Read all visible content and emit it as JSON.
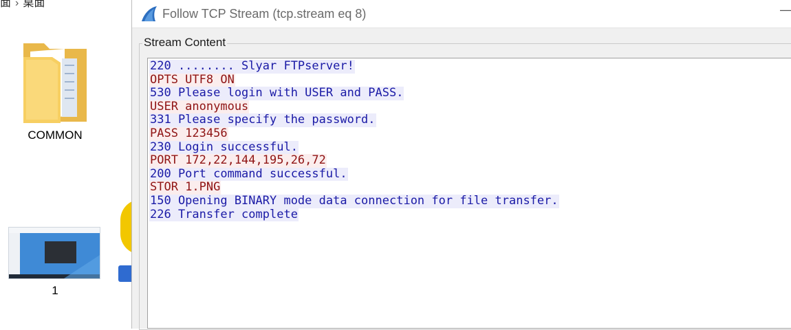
{
  "desktop": {
    "breadcrumb": {
      "parent": "面",
      "current": "桌面"
    },
    "items": [
      {
        "label": "COMMON"
      },
      {
        "label": "1"
      }
    ]
  },
  "window": {
    "title": "Follow TCP Stream (tcp.stream eq 8)",
    "minimize_label": "—",
    "group_label": "Stream Content",
    "lines": [
      {
        "dir": "server",
        "text": "220 ........ Slyar FTPserver!"
      },
      {
        "dir": "client",
        "text": "OPTS UTF8 ON"
      },
      {
        "dir": "server",
        "text": "530 Please login with USER and PASS."
      },
      {
        "dir": "client",
        "text": "USER anonymous"
      },
      {
        "dir": "server",
        "text": "331 Please specify the password."
      },
      {
        "dir": "client",
        "text": "PASS 123456"
      },
      {
        "dir": "server",
        "text": "230 Login successful."
      },
      {
        "dir": "client",
        "text": "PORT 172,22,144,195,26,72"
      },
      {
        "dir": "server",
        "text": "200 Port command successful."
      },
      {
        "dir": "client",
        "text": "STOR 1.PNG"
      },
      {
        "dir": "server",
        "text": "150 Opening BINARY mode data connection for file transfer."
      },
      {
        "dir": "server",
        "text": "226 Transfer complete"
      }
    ]
  },
  "colors": {
    "server_text": "#1a1aa6",
    "server_bg": "#ececfb",
    "client_text": "#8f1414",
    "client_bg": "#fbeded",
    "shark_fin": "#2d6fc0"
  }
}
